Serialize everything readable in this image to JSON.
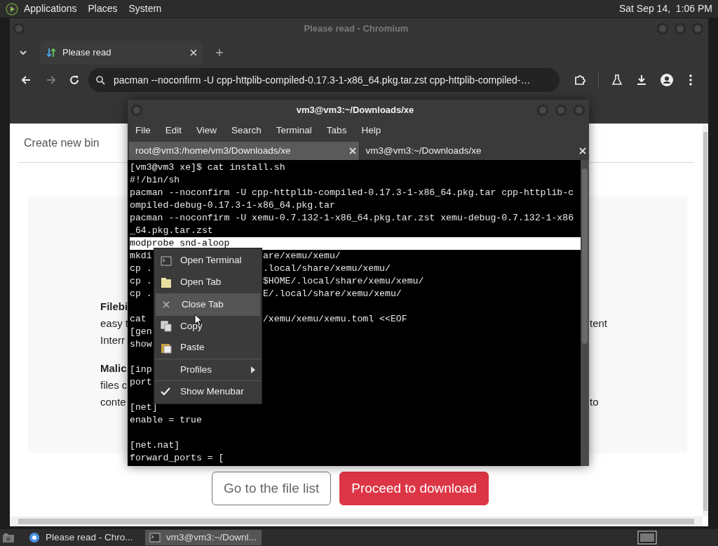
{
  "top_panel": {
    "menus": [
      "Applications",
      "Places",
      "System"
    ],
    "clock": "Sat Sep 14,  1:06 PM"
  },
  "browser": {
    "title": "Please read - Chromium",
    "tabs": [
      {
        "label": "Please read",
        "selected": true
      }
    ],
    "address": "pacman --noconfirm -U cpp-httplib-compiled-0.17.3-1-x86_64.pkg.tar.zst cpp-httplib-compiled-…",
    "page": {
      "nav_link": "Create new bin",
      "paragraphs": [
        {
          "lines": [
            {
              "left": "Filebi",
              "bold": true
            },
            {
              "left": "easy t",
              "right": "tent"
            },
            {
              "left": "Interr"
            }
          ]
        },
        {
          "lines": [
            {
              "left": "Malic",
              "bold": true
            },
            {
              "left": "files c"
            },
            {
              "left": "conte",
              "right": "to"
            }
          ]
        }
      ],
      "buttons": [
        {
          "label": "Go to the file list",
          "kind": "secondary"
        },
        {
          "label": "Proceed to download",
          "kind": "primary"
        }
      ]
    }
  },
  "terminal": {
    "title": "vm3@vm3:~/Downloads/xe",
    "menu": [
      "File",
      "Edit",
      "View",
      "Search",
      "Terminal",
      "Tabs",
      "Help"
    ],
    "tabs": [
      {
        "label": "root@vm3:/home/vm3/Downloads/xe",
        "selected": false
      },
      {
        "label": "vm3@vm3:~/Downloads/xe",
        "selected": true
      }
    ],
    "lines": [
      {
        "text": "[vm3@vm3 xe]$ cat install.sh",
        "selected": false
      },
      {
        "text": "#!/bin/sh",
        "selected": false
      },
      {
        "text": "pacman --noconfirm -U cpp-httplib-compiled-0.17.3-1-x86_64.pkg.tar cpp-httplib-c",
        "selected": false
      },
      {
        "text": "ompiled-debug-0.17.3-1-x86_64.pkg.tar",
        "selected": false
      },
      {
        "text": "pacman --noconfirm -U xemu-0.7.132-1-x86_64.pkg.tar.zst xemu-debug-0.7.132-1-x86",
        "selected": false
      },
      {
        "text": "_64.pkg.tar.zst",
        "selected": false
      },
      {
        "text": "modprobe snd-aloop",
        "selected": true
      },
      {
        "text": "mkdi",
        "right": "are/xemu/xemu/",
        "selected": false
      },
      {
        "text": "cp .",
        "right": ".local/share/xemu/xemu/",
        "selected": false
      },
      {
        "text": "cp .",
        "right": "$HOME/.local/share/xemu/xemu/",
        "selected": false
      },
      {
        "text": "cp .",
        "right": "E/.local/share/xemu/xemu/",
        "selected": false
      },
      {
        "text": "cat",
        "right": "/xemu/xemu/xemu.toml <<EOF",
        "blank_before": true,
        "selected": false
      },
      {
        "text": "[gen",
        "selected": false
      },
      {
        "text": "show",
        "selected": false
      },
      {
        "text": "[inp",
        "blank_before": true,
        "selected": false
      },
      {
        "text": "port",
        "selected": false
      },
      {
        "text": "[net]",
        "blank_before": true,
        "selected": false
      },
      {
        "text": "enable = true",
        "selected": false
      },
      {
        "text": "[net.nat]",
        "blank_before": true,
        "selected": false
      },
      {
        "text": "forward_ports = [",
        "selected": false
      }
    ]
  },
  "context_menu": {
    "items": [
      {
        "label": "Open Terminal",
        "kind": "terminal",
        "selected": false
      },
      {
        "label": "Open Tab",
        "kind": "tab",
        "selected": false
      },
      {
        "label": "Close Tab",
        "kind": "close",
        "selected": true,
        "separator_before": true
      },
      {
        "label": "Copy",
        "kind": "copy",
        "selected": false,
        "separator_before": true
      },
      {
        "label": "Paste",
        "kind": "paste",
        "selected": false
      },
      {
        "label": "Profiles",
        "kind": "submenu",
        "selected": false,
        "separator_before": true
      },
      {
        "label": "Show Menubar",
        "kind": "check",
        "checked": true,
        "selected": false,
        "separator_before": true
      }
    ]
  },
  "taskbar": {
    "items": [
      {
        "label": "Please read - Chro...",
        "kind": "browser",
        "selected": false
      },
      {
        "label": "vm3@vm3:~/Downl...",
        "kind": "terminal",
        "selected": true
      }
    ]
  }
}
